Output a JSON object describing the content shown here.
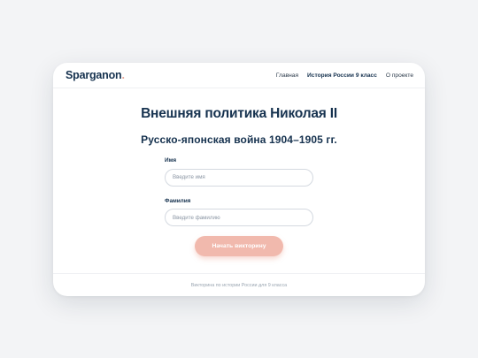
{
  "header": {
    "logo": "Sparganon",
    "logo_dot": ".",
    "nav": [
      {
        "label": "Главная"
      },
      {
        "label": "История России 9 класс"
      },
      {
        "label": "О проекте"
      }
    ]
  },
  "main": {
    "title": "Внешняя политика Николая II",
    "subtitle": "Русско-японская война 1904–1905 гг.",
    "form": {
      "first_name_label": "Имя",
      "first_name_placeholder": "Введите имя",
      "last_name_label": "Фамилия",
      "last_name_placeholder": "Введите фамилию",
      "submit_label": "Начать викторину"
    }
  },
  "footer": {
    "text": "Викторина по истории России для 9 класса"
  },
  "colors": {
    "brand": "#16324f",
    "accent": "#f1b9ad",
    "background": "#f3f4f6"
  }
}
